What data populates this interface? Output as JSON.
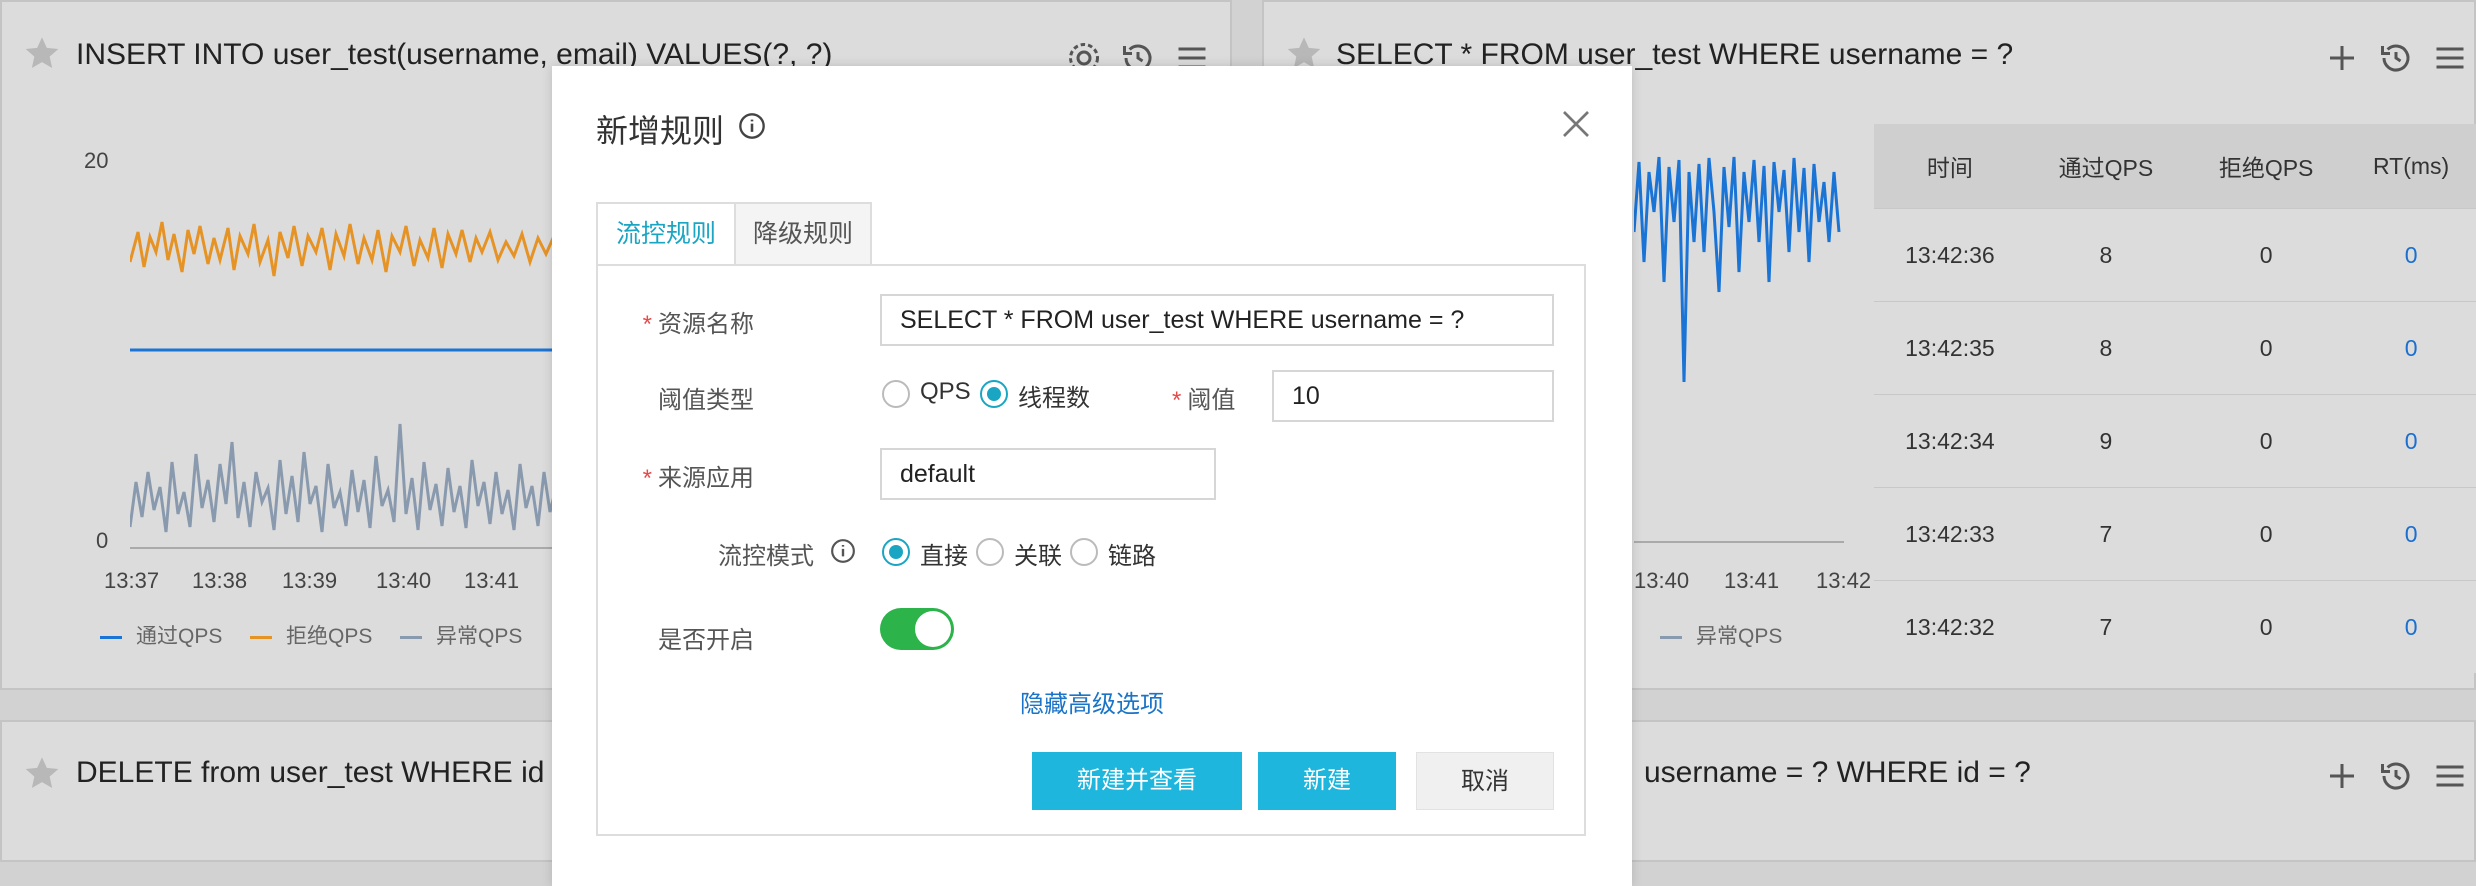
{
  "panels": {
    "p1": {
      "title": "INSERT INTO user_test(username, email) VALUES(?, ?)",
      "y_top": "20",
      "y_bottom": "0",
      "x_ticks": [
        "13:37",
        "13:38",
        "13:39",
        "13:40",
        "13:41"
      ],
      "legend": [
        "通过QPS",
        "拒绝QPS",
        "异常QPS"
      ]
    },
    "p2": {
      "title": "SELECT * FROM user_test WHERE username = ?",
      "x_ticks": [
        "13:40",
        "13:41",
        "13:42"
      ],
      "legend": [
        "异常QPS"
      ],
      "table": {
        "headers": [
          "时间",
          "通过QPS",
          "拒绝QPS",
          "RT(ms)"
        ],
        "rows": [
          [
            "13:42:36",
            "8",
            "0",
            "0"
          ],
          [
            "13:42:35",
            "8",
            "0",
            "0"
          ],
          [
            "13:42:34",
            "9",
            "0",
            "0"
          ],
          [
            "13:42:33",
            "7",
            "0",
            "0"
          ],
          [
            "13:42:32",
            "7",
            "0",
            "0"
          ]
        ]
      }
    },
    "p3": {
      "title": "DELETE from user_test WHERE id ="
    },
    "p4": {
      "title": "username = ? WHERE id = ?"
    }
  },
  "colors": {
    "pass": "#1a74d6",
    "block": "#e69326",
    "exception": "#8a9aae",
    "accent": "#1aa6c3",
    "toggle_on": "#2cb34a"
  },
  "modal": {
    "title": "新增规则",
    "tabs": [
      "流控规则",
      "降级规则"
    ],
    "fields": {
      "resource_label": "资源名称",
      "resource_value": "SELECT * FROM user_test WHERE username = ?",
      "threshold_type_label": "阈值类型",
      "threshold_type_options": [
        "QPS",
        "线程数"
      ],
      "threshold_type_selected": "线程数",
      "threshold_label": "阈值",
      "threshold_value": "10",
      "origin_label": "来源应用",
      "origin_value": "default",
      "mode_label": "流控模式",
      "mode_options": [
        "直接",
        "关联",
        "链路"
      ],
      "mode_selected": "直接",
      "enabled_label": "是否开启",
      "enabled": true
    },
    "advanced_link": "隐藏高级选项",
    "buttons": {
      "create_and_view": "新建并查看",
      "create": "新建",
      "cancel": "取消"
    }
  }
}
